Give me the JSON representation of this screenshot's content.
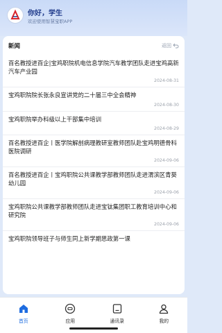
{
  "header": {
    "greeting": "你好，学生",
    "welcome": "欢迎使用智慧宝职APP"
  },
  "news": {
    "title": "新闻",
    "back_label": "返回",
    "items": [
      {
        "title": "百名教授进百企|宝鸡职院机电信息学院汽车教学团队走进宝鸡高新汽车产业园",
        "date": "2024-08-31"
      },
      {
        "title": "宝鸡职院院长张永良宣讲党的二十届三中全会精神",
        "date": "2024-08-30"
      },
      {
        "title": "宝鸡职院举办科级以上干部集中培训",
        "date": "2024-08-29"
      },
      {
        "title": "百名教授进百企丨医学院解剖病理教研室教师团队赴宝鸡明德骨科医院调研",
        "date": "2024-09-06"
      },
      {
        "title": "百名教授进百企丨宝鸡职院公共课教学部教师团队走进渭滨区青葵幼儿园",
        "date": "2024-09-06"
      },
      {
        "title": "宝鸡职院公共课教学部教师团队走进宝钛集团职工教育培训中心和研究院",
        "date": "2024-09-06"
      },
      {
        "title": "宝鸡职院领导班子与师生同上新学期思政第一课",
        "date": ""
      }
    ]
  },
  "tabs": [
    {
      "label": "首页",
      "icon": "home-icon"
    },
    {
      "label": "应用",
      "icon": "apps-icon"
    },
    {
      "label": "通讯录",
      "icon": "contacts-icon"
    },
    {
      "label": "我的",
      "icon": "user-icon"
    }
  ],
  "colors": {
    "accent": "#1e6ce0",
    "logo_red": "#d8232a",
    "logo_blue": "#1f3a8a"
  }
}
